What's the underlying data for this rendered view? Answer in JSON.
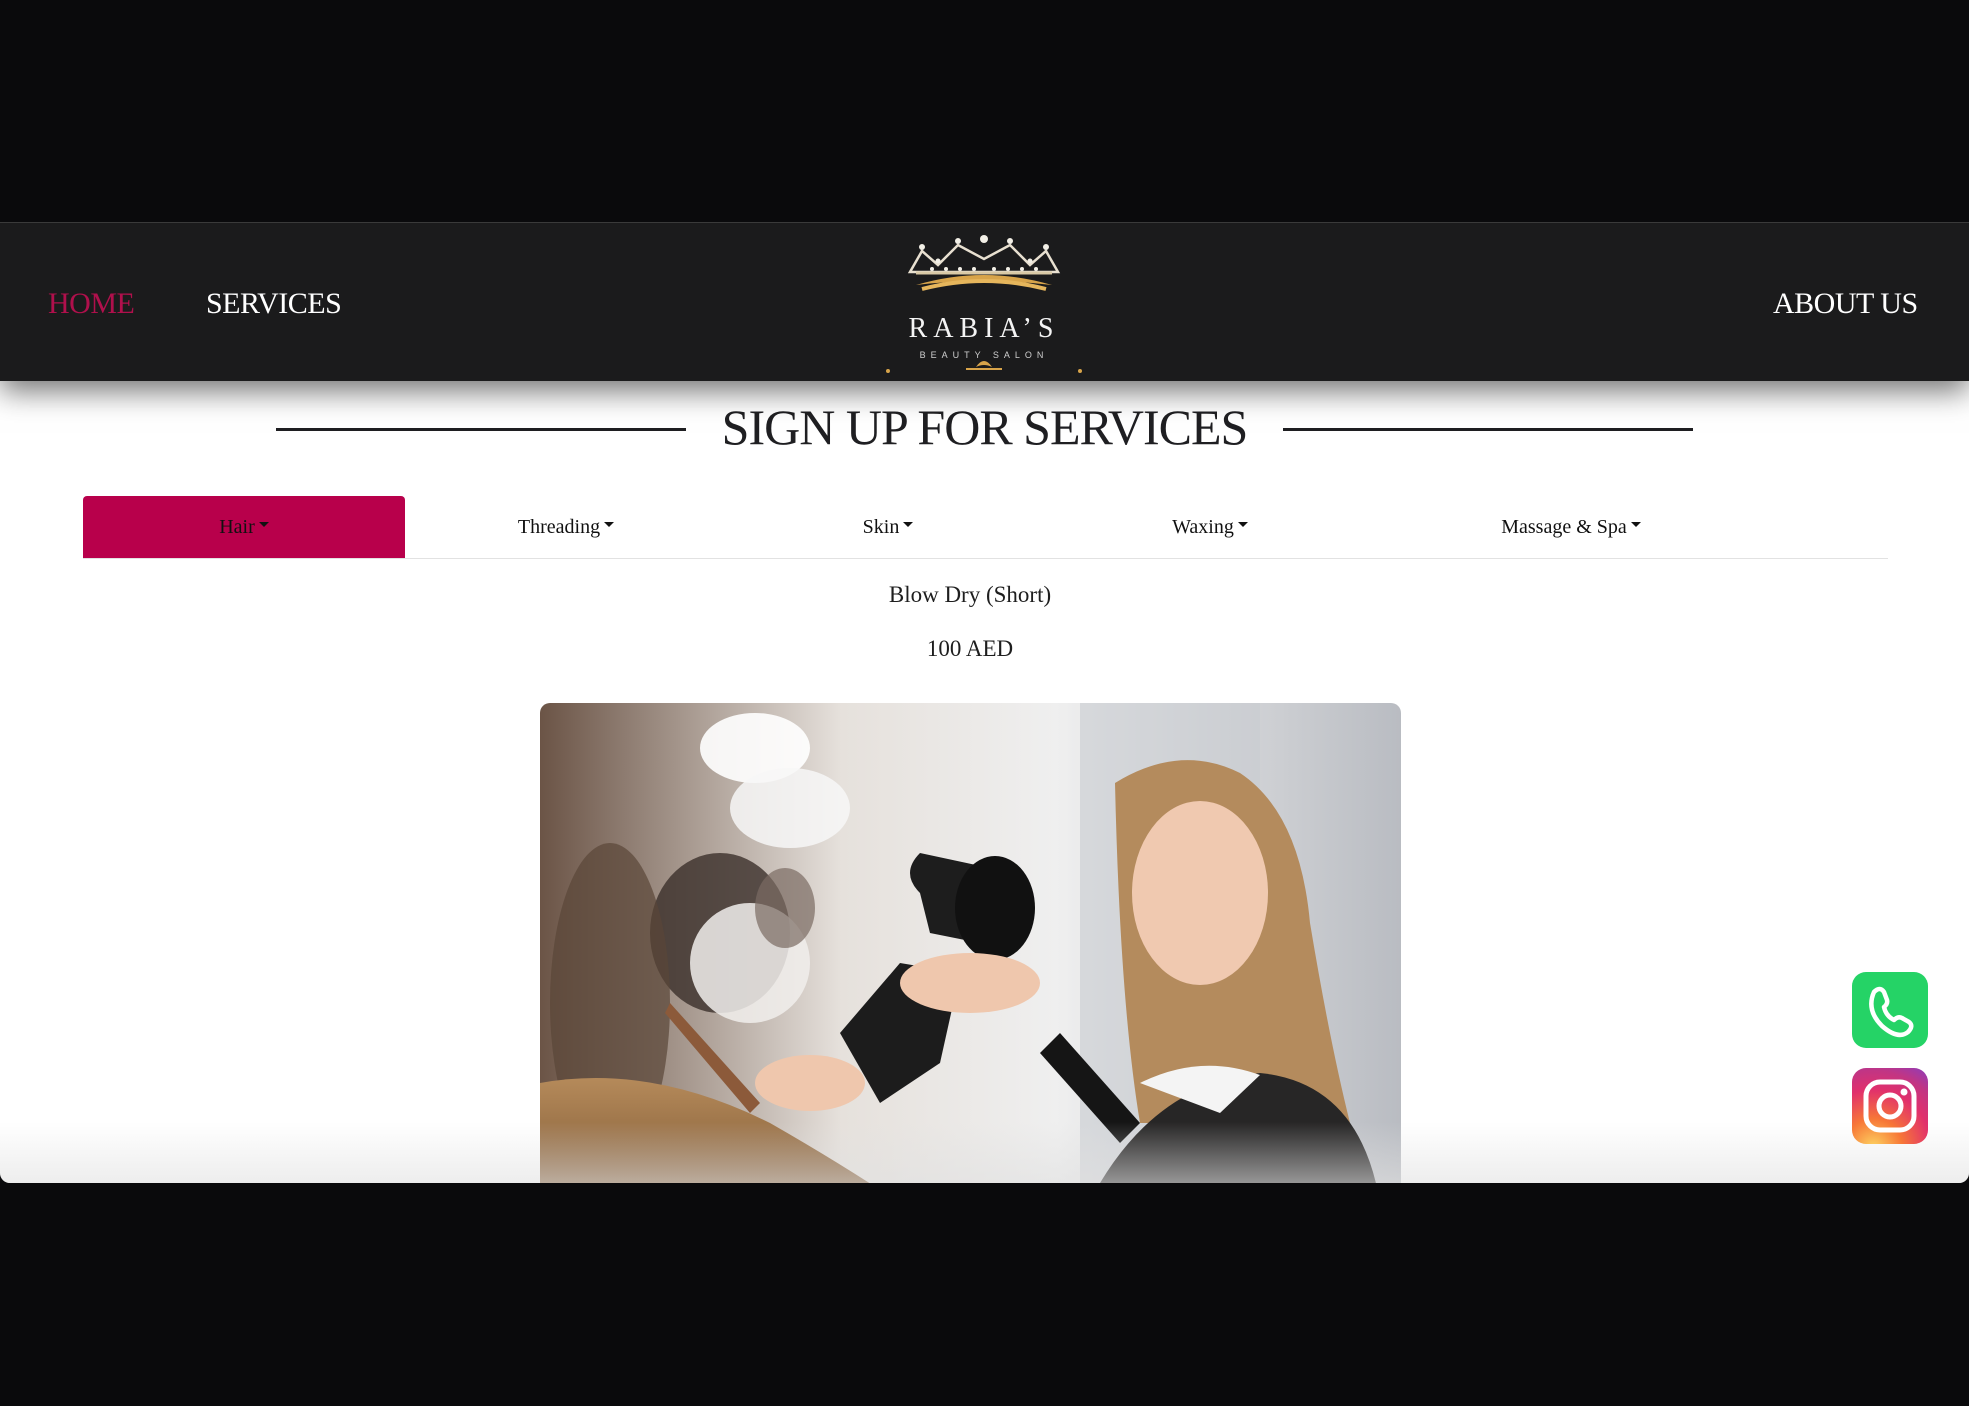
{
  "nav": {
    "home": "HOME",
    "services": "SERVICES",
    "about": "ABOUT US",
    "logo_name": "RABIA’S",
    "logo_sub": "BEAUTY SALON",
    "active_color": "#b0104c"
  },
  "section": {
    "title": "SIGN UP FOR SERVICES"
  },
  "tabs": [
    {
      "label": "Hair",
      "active": true
    },
    {
      "label": "Threading",
      "active": false
    },
    {
      "label": "Skin",
      "active": false
    },
    {
      "label": "Waxing",
      "active": false
    },
    {
      "label": "Massage & Spa",
      "active": false
    }
  ],
  "tab_active_color": "#b8004b",
  "service": {
    "name": "Blow Dry (Short)",
    "price": "100 AED",
    "image_icon": "hairdresser-blow-dry-photo"
  },
  "floating": {
    "whatsapp_icon": "whatsapp-icon",
    "whatsapp_color": "#25d366",
    "instagram_icon": "instagram-icon"
  }
}
